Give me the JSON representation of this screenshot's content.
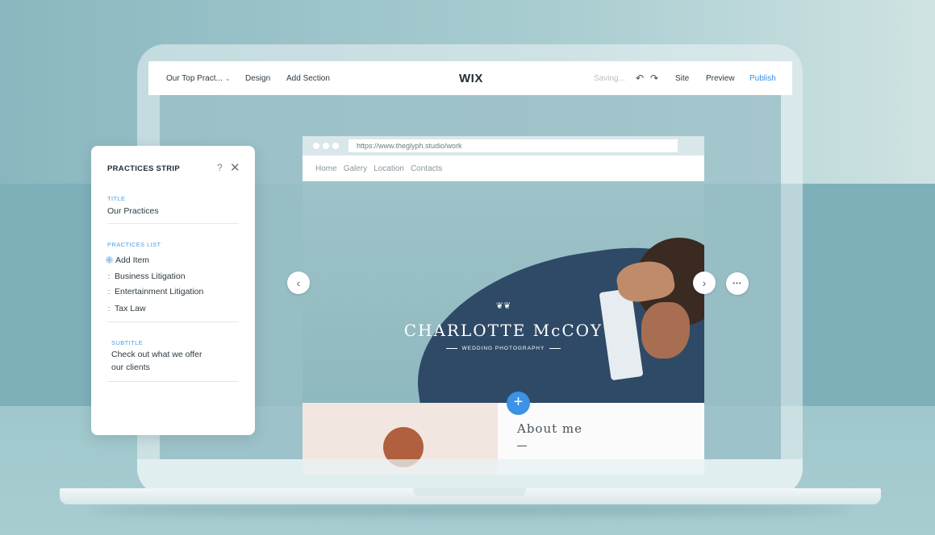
{
  "editor": {
    "page_selector": "Our Top Pract...",
    "design_label": "Design",
    "add_section_label": "Add Section",
    "logo": "WIX",
    "status": "Saving...",
    "undo_icon": "undo-icon",
    "redo_icon": "redo-icon",
    "site_label": "Site",
    "preview_label": "Preview",
    "publish_label": "Publish",
    "accent_color": "#3b8fe3"
  },
  "browser": {
    "url": "https://www.theglyph.studio/work",
    "nav": [
      "Home",
      "Galery",
      "Location",
      "Contacts"
    ]
  },
  "hero": {
    "ornament": "❦❦",
    "title": "CHARLOTTE McCOY",
    "subtitle": "WEDDING PHOTOGRAPHY"
  },
  "about": {
    "heading": "About me"
  },
  "controls": {
    "prev": "‹",
    "next": "›",
    "more": "•••",
    "add": "+"
  },
  "panel": {
    "title": "PRACTICES STRIP",
    "help": "?",
    "close": "✕",
    "title_label": "TITLE",
    "title_value": "Our Practices",
    "list_label": "PRACTICES LIST",
    "add_item": "Add Item",
    "items": [
      "Business Litigation",
      "Entertainment Litigation",
      "Tax Law"
    ],
    "subtitle_label": "SUBTITLE",
    "subtitle_line1": "Check out what we offer",
    "subtitle_line2": "our clients"
  }
}
